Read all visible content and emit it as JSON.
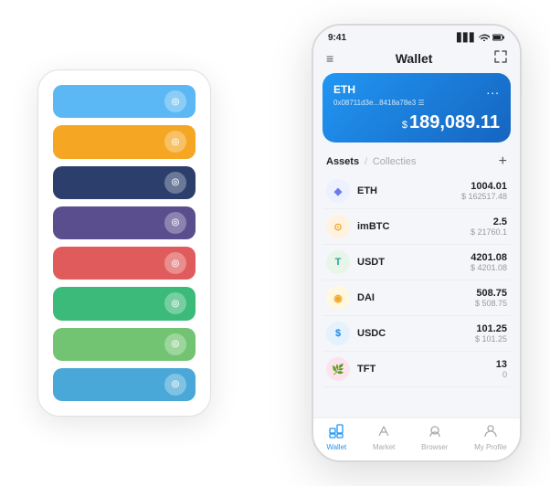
{
  "scene": {
    "back_phone": {
      "cards": [
        {
          "id": "card-blue",
          "color": "#5bb8f5",
          "icon": "◎"
        },
        {
          "id": "card-orange",
          "color": "#f5a623",
          "icon": "◎"
        },
        {
          "id": "card-dark",
          "color": "#2c3e6b",
          "icon": "◎"
        },
        {
          "id": "card-purple",
          "color": "#5b4e8e",
          "icon": "◎"
        },
        {
          "id": "card-red",
          "color": "#e05c5c",
          "icon": "◎"
        },
        {
          "id": "card-green",
          "color": "#3cba7a",
          "icon": "◎"
        },
        {
          "id": "card-light-green",
          "color": "#72c472",
          "icon": "◎"
        },
        {
          "id": "card-sky",
          "color": "#4aa8d8",
          "icon": "◎"
        }
      ]
    },
    "front_phone": {
      "status_bar": {
        "time": "9:41",
        "signal": "▋▋▋",
        "wifi": "wifi",
        "battery": "🔋"
      },
      "header": {
        "menu_icon": "≡",
        "title": "Wallet",
        "expand_icon": "⛶"
      },
      "eth_card": {
        "label": "ETH",
        "dots": "...",
        "address": "0x08711d3e...8418a78e3 ☰",
        "dollar_sign": "$",
        "amount": "189,089.11"
      },
      "assets_section": {
        "tab_active": "Assets",
        "separator": "/",
        "tab_inactive": "Collecties",
        "add_icon": "+"
      },
      "assets": [
        {
          "symbol": "ETH",
          "icon_char": "◆",
          "icon_color": "#ecf0ff",
          "icon_text_color": "#6b7ae8",
          "amount": "1004.01",
          "usd": "$ 162517.48"
        },
        {
          "symbol": "imBTC",
          "icon_char": "⊙",
          "icon_color": "#fff3e0",
          "icon_text_color": "#f5a623",
          "amount": "2.5",
          "usd": "$ 21760.1"
        },
        {
          "symbol": "USDT",
          "icon_char": "T",
          "icon_color": "#e8f5e9",
          "icon_text_color": "#26a69a",
          "amount": "4201.08",
          "usd": "$ 4201.08"
        },
        {
          "symbol": "DAI",
          "icon_char": "◉",
          "icon_color": "#fff8e1",
          "icon_text_color": "#f5a623",
          "amount": "508.75",
          "usd": "$ 508.75"
        },
        {
          "symbol": "USDC",
          "icon_char": "$",
          "icon_color": "#e3f2fd",
          "icon_text_color": "#1e88e5",
          "amount": "101.25",
          "usd": "$ 101.25"
        },
        {
          "symbol": "TFT",
          "icon_char": "🌿",
          "icon_color": "#fce4ec",
          "icon_text_color": "#e91e63",
          "amount": "13",
          "usd": "0"
        }
      ],
      "bottom_nav": [
        {
          "id": "wallet",
          "label": "Wallet",
          "icon": "⊙",
          "active": true
        },
        {
          "id": "market",
          "label": "Market",
          "icon": "↗",
          "active": false
        },
        {
          "id": "browser",
          "label": "Browser",
          "icon": "☻",
          "active": false
        },
        {
          "id": "profile",
          "label": "My Profile",
          "icon": "◉",
          "active": false
        }
      ]
    }
  }
}
